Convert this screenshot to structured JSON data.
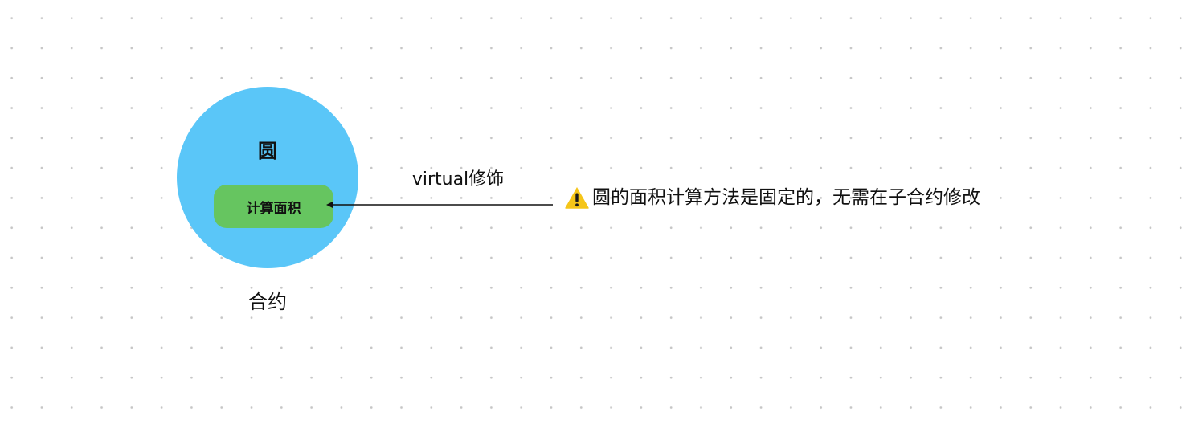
{
  "diagram": {
    "circle": {
      "title": "圆",
      "fill": "#5AC6F8"
    },
    "method": {
      "label": "计算面积",
      "fill": "#66C560"
    },
    "contract_label": "合约",
    "edge": {
      "label": "virtual修饰",
      "color": "#111111"
    },
    "note": {
      "icon": "warning-icon",
      "icon_color": "#F5C518",
      "text": "圆的面积计算方法是固定的，无需在子合约修改"
    }
  }
}
